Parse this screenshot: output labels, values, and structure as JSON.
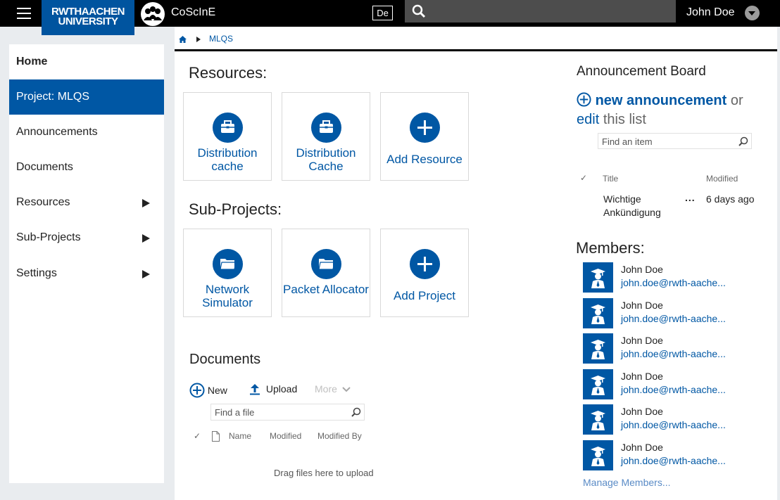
{
  "header": {
    "logo_line1": "RWTHAACHEN",
    "logo_line2": "UNIVERSITY",
    "app_name": "CoScInE",
    "language": "De",
    "search_placeholder": "",
    "user_name": "John Doe"
  },
  "sidebar": {
    "items": [
      {
        "label": "Home"
      },
      {
        "label": "Project: MLQS"
      },
      {
        "label": "Announcements"
      },
      {
        "label": "Documents"
      },
      {
        "label": "Resources"
      },
      {
        "label": "Sub-Projects"
      },
      {
        "label": "Settings"
      }
    ]
  },
  "breadcrumb": {
    "current": "MLQS"
  },
  "resources": {
    "title": "Resources:",
    "tiles": [
      {
        "label": "Distribution cache",
        "icon": "briefcase-icon"
      },
      {
        "label": "Distribution Cache",
        "icon": "briefcase-icon"
      },
      {
        "label": "Add Resource",
        "icon": "plus-icon"
      }
    ]
  },
  "subprojects": {
    "title": "Sub-Projects:",
    "tiles": [
      {
        "label": "Network Simulator",
        "icon": "folder-icon"
      },
      {
        "label": "Packet Allocator",
        "icon": "folder-icon"
      },
      {
        "label": "Add Project",
        "icon": "plus-icon"
      }
    ]
  },
  "documents": {
    "title": "Documents",
    "new_label": "New",
    "upload_label": "Upload",
    "more_label": "More",
    "find_placeholder": "Find a file",
    "columns": [
      "Name",
      "Modified",
      "Modified By"
    ],
    "drop_hint": "Drag files here to upload"
  },
  "announcements": {
    "title": "Announcement Board",
    "new_label": "new announcement",
    "or_text": "or",
    "edit_label": "edit",
    "edit_suffix": "this list",
    "find_placeholder": "Find an item",
    "columns": [
      "Title",
      "Modified"
    ],
    "items": [
      {
        "title": "Wichtige Ankündigung",
        "modified": "6 days ago",
        "more": "..."
      }
    ]
  },
  "members": {
    "title": "Members:",
    "list": [
      {
        "name": "John Doe",
        "email": "john.doe@rwth-aache..."
      },
      {
        "name": "John Doe",
        "email": "john.doe@rwth-aache..."
      },
      {
        "name": "John Doe",
        "email": "john.doe@rwth-aache..."
      },
      {
        "name": "John Doe",
        "email": "john.doe@rwth-aache..."
      },
      {
        "name": "John Doe",
        "email": "john.doe@rwth-aache..."
      },
      {
        "name": "John Doe",
        "email": "john.doe@rwth-aache..."
      }
    ],
    "manage_label": "Manage Members..."
  },
  "colors": {
    "brand": "#00549f",
    "accent": "#0057a4",
    "topbar": "#000000",
    "background": "#e9ecef"
  }
}
